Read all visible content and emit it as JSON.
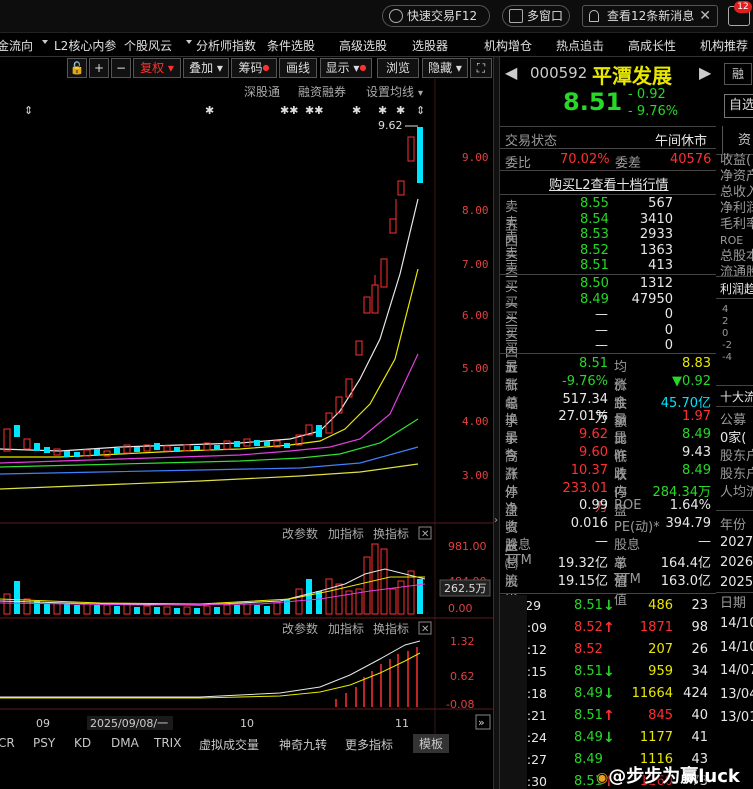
{
  "topbar": {
    "quick_trade": "快速交易F12",
    "multi_window": "多窗口",
    "news_btn": "查看12条新消息",
    "badge": "12"
  },
  "menu": [
    "金流向",
    "L2核心内参",
    "个股风云",
    "分析师指数",
    "条件选股",
    "高级选股",
    "选股器",
    "机构增仓",
    "热点追击",
    "高成长性",
    "机构推荐"
  ],
  "chart_toolbar": {
    "fuquan": "复权",
    "overlay": "叠加",
    "chips": "筹码",
    "draw": "画线",
    "display": "显示",
    "browse": "浏览",
    "hide": "隐藏",
    "subtools": [
      "深股通",
      "融资融券",
      "设置均线"
    ],
    "max_label": "9.62"
  },
  "price_axis": [
    "9.00",
    "8.00",
    "7.00",
    "6.00",
    "5.00",
    "4.00",
    "3.00"
  ],
  "vol_panel": {
    "labels": [
      "改参数",
      "加指标",
      "换指标"
    ],
    "axis": [
      "981.00",
      "484.00",
      "0.00"
    ],
    "current": "262.5万"
  },
  "macd_panel": {
    "labels": [
      "改参数",
      "加指标",
      "换指标"
    ],
    "axis": [
      "1.32",
      "0.62",
      "-0.08"
    ]
  },
  "time_axis": [
    "09",
    "2025/09/08/一",
    "10",
    "11"
  ],
  "indicator_tabs": [
    "CR",
    "PSY",
    "KD",
    "DMA",
    "TRIX",
    "虚拟成交量",
    "神奇九转",
    "更多指标",
    "模板"
  ],
  "stock": {
    "code": "000592",
    "name": "平潭发展",
    "price": "8.51",
    "change": "- 0.92",
    "change_pct": "- 9.76%",
    "status_label": "交易状态",
    "status": "午间休市"
  },
  "weibi": {
    "label1": "委比",
    "v1": "70.02%",
    "label2": "委差",
    "v2": "40576"
  },
  "l2_link": "购买L2查看十档行情",
  "asks": [
    {
      "label": "卖五",
      "price": "8.55",
      "vol": "567"
    },
    {
      "label": "卖四",
      "price": "8.54",
      "vol": "3410"
    },
    {
      "label": "卖三",
      "price": "8.53",
      "vol": "2933"
    },
    {
      "label": "卖二",
      "price": "8.52",
      "vol": "1363"
    },
    {
      "label": "卖一",
      "price": "8.51",
      "vol": "413"
    }
  ],
  "bids": [
    {
      "label": "买一",
      "price": "8.50",
      "vol": "1312"
    },
    {
      "label": "买二",
      "price": "8.49",
      "vol": "47950"
    },
    {
      "label": "买三",
      "price": "—",
      "vol": "0"
    },
    {
      "label": "买四",
      "price": "—",
      "vol": "0"
    },
    {
      "label": "买五",
      "price": "—",
      "vol": "0"
    }
  ],
  "stats": [
    {
      "l1": "最新",
      "v1": "8.51",
      "c1": "grn",
      "l2": "均价",
      "v2": "8.83",
      "c2": "yel"
    },
    {
      "l1": "涨幅",
      "v1": "-9.76%",
      "c1": "grn",
      "l2": "涨跌",
      "v2": "▼0.92",
      "c2": "grn"
    },
    {
      "l1": "总手",
      "v1": "517.34万",
      "c1": "wht",
      "l2": "金额",
      "v2": "45.70亿",
      "c2": "cyan"
    },
    {
      "l1": "换手*",
      "v1": "27.01%",
      "c1": "wht",
      "l2": "量比",
      "v2": "1.97",
      "c2": "red"
    },
    {
      "l1": "最高",
      "v1": "9.62",
      "c1": "red",
      "l2": "最低",
      "v2": "8.49",
      "c2": "grn"
    },
    {
      "l1": "今开",
      "v1": "9.60",
      "c1": "red",
      "l2": "昨收",
      "v2": "9.43",
      "c2": "wht"
    },
    {
      "l1": "涨停",
      "v1": "10.37",
      "c1": "red",
      "l2": "跌停",
      "v2": "8.49",
      "c2": "grn"
    },
    {
      "l1": "外盘",
      "v1": "233.01万",
      "c1": "red",
      "l2": "内盘",
      "v2": "284.34万",
      "c2": "grn"
    },
    {
      "l1": "净资产",
      "v1": "0.99",
      "c1": "wht",
      "l2": "ROE",
      "v2": "1.64%",
      "c2": "wht"
    },
    {
      "l1": "收益㈢",
      "v1": "0.016",
      "c1": "wht",
      "l2": "PE(动)*",
      "v2": "394.79",
      "c2": "wht"
    },
    {
      "l1": "股息TTM",
      "v1": "—",
      "c1": "wht",
      "l2": "股息率TTM",
      "v2": "—",
      "c2": "wht"
    },
    {
      "l1": "总股本",
      "v1": "19.32亿",
      "c1": "wht",
      "l2": "总值",
      "v2": "164.4亿",
      "c2": "wht"
    },
    {
      "l1": "流通股",
      "v1": "19.15亿",
      "c1": "wht",
      "l2": "流值",
      "v2": "163.0亿",
      "c2": "wht"
    }
  ],
  "ticks": [
    {
      "t": "11:29",
      "p": "8.51",
      "pc": "grn",
      "a": "↓",
      "ac": "grn",
      "v": "486",
      "n": "23"
    },
    {
      "t": ":09",
      "p": "8.52",
      "pc": "red",
      "a": "↑",
      "ac": "red",
      "v": "1871",
      "n": "98"
    },
    {
      "t": ":12",
      "p": "8.52",
      "pc": "red",
      "a": "",
      "ac": "wht",
      "v": "207",
      "n": "26"
    },
    {
      "t": ":15",
      "p": "8.51",
      "pc": "grn",
      "a": "↓",
      "ac": "grn",
      "v": "959",
      "n": "34"
    },
    {
      "t": ":18",
      "p": "8.49",
      "pc": "grn",
      "a": "↓",
      "ac": "grn",
      "v": "11664",
      "n": "424"
    },
    {
      "t": ":21",
      "p": "8.51",
      "pc": "grn",
      "a": "↑",
      "ac": "red",
      "v": "845",
      "n": "40"
    },
    {
      "t": ":24",
      "p": "8.49",
      "pc": "grn",
      "a": "↓",
      "ac": "grn",
      "v": "1177",
      "n": "41"
    },
    {
      "t": ":27",
      "p": "8.49",
      "pc": "grn",
      "a": "",
      "ac": "wht",
      "v": "1116",
      "n": "43"
    },
    {
      "t": ":30",
      "p": "8.51",
      "pc": "grn",
      "a": "↑",
      "ac": "red",
      "v": "1260",
      "n": "73"
    },
    {
      "t": ":33",
      "p": "8.51",
      "pc": "grn",
      "a": "",
      "ac": "wht",
      "v": "1159",
      "n": "73"
    }
  ],
  "far_right": {
    "btn1": "融",
    "btn2": "自选",
    "tab": "资",
    "lines": [
      "收益(",
      "净资产",
      "总收入",
      "净利润",
      "毛利率",
      "ROE",
      "总股本",
      "流通股"
    ],
    "profit": "利润趋",
    "mini_axis": [
      "4",
      "2",
      "0",
      "-2",
      "-4"
    ],
    "shareholders": "十大流",
    "list": [
      "公募",
      "0家(",
      "股东户",
      "股东户",
      "人均流"
    ],
    "year_label": "年份",
    "years": [
      "2027",
      "2026",
      "2025"
    ],
    "date_label": "日期",
    "dates": [
      "14/10",
      "14/10",
      "14/07",
      "13/04",
      "13/01"
    ]
  },
  "watermark": "@步步为赢luck",
  "colors": {
    "up": "#ff3030",
    "down": "#27d827",
    "cyan": "#00e5ff",
    "yellow": "#e8e800",
    "bg": "#000000"
  }
}
